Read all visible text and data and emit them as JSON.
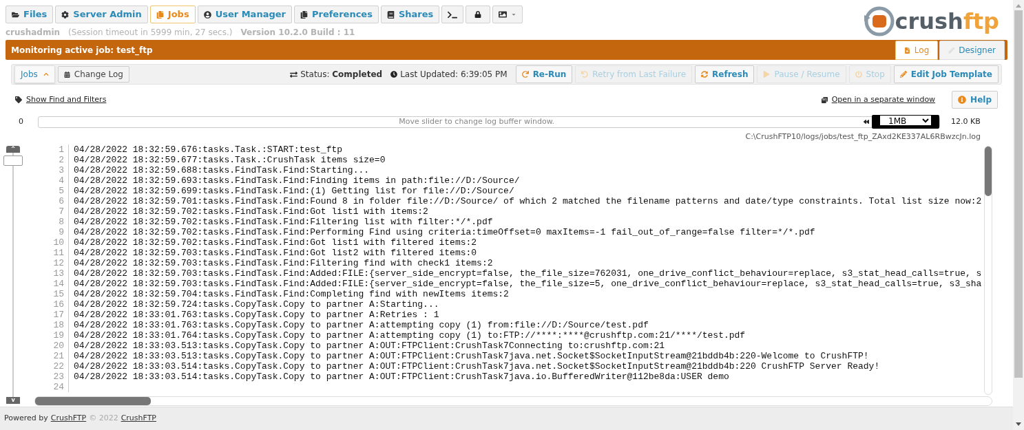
{
  "nav_tabs": [
    {
      "kind": "text",
      "label": "Files",
      "selected": false
    },
    {
      "kind": "text",
      "label": "Server Admin",
      "selected": false
    },
    {
      "kind": "text",
      "label": "Jobs",
      "selected": true
    },
    {
      "kind": "text",
      "label": "User Manager",
      "selected": false
    },
    {
      "kind": "text",
      "label": "Preferences",
      "selected": false
    },
    {
      "kind": "text",
      "label": "Shares",
      "selected": false
    },
    {
      "kind": "terminal",
      "selected": false
    },
    {
      "kind": "lock",
      "selected": false
    },
    {
      "kind": "image",
      "selected": false
    }
  ],
  "logo": {
    "word1": "crush",
    "word2": "ftp"
  },
  "session": {
    "user": "crushadmin",
    "timeout": "(Session timeout in 5999 min, 27 secs.)",
    "version": "Version 10.2.0 Build : 11"
  },
  "banner": {
    "title": "Monitoring active job: test_ftp"
  },
  "view_tabs": [
    {
      "label": "Log",
      "selected": true
    },
    {
      "label": "Designer",
      "selected": false
    }
  ],
  "toolbar": {
    "jobs_menu": "Jobs",
    "change_log": "Change Log",
    "status_label": "Status:",
    "status_value": "Completed",
    "updated_label": "Last Updated:",
    "updated_value": "6:39:05 PM",
    "buttons": [
      {
        "label": "Re-Run",
        "disabled": false
      },
      {
        "label": "Retry from Last Failure",
        "disabled": true
      },
      {
        "label": "Refresh",
        "disabled": false
      },
      {
        "label": "Pause / Resume",
        "disabled": true
      },
      {
        "label": "Stop",
        "disabled": true
      },
      {
        "label": "Edit Job Template",
        "disabled": false
      }
    ]
  },
  "find_link": "Show Find and Filters",
  "open_window_link": "Open in a separate window",
  "help_button": "Help",
  "buffer": {
    "min": "0",
    "hint": "Move slider to change log buffer window.",
    "size_option": "1MB",
    "size": "12.0 KB"
  },
  "log_path": "C:\\CrushFTP10/logs/jobs/test_ftp_ZAxd2KE337AL6RBwzcJn.log",
  "log_lines": [
    {
      "number": "1",
      "text": "04/28/2022 18:32:59.676:tasks.Task.:START:test_ftp"
    },
    {
      "number": "2",
      "text": "04/28/2022 18:32:59.677:tasks.Task.:CrushTask items size=0"
    },
    {
      "number": "3",
      "text": "04/28/2022 18:32:59.688:tasks.FindTask.Find:Starting..."
    },
    {
      "number": "4",
      "text": "04/28/2022 18:32:59.693:tasks.FindTask.Find:Finding items in path:file://D:/Source/"
    },
    {
      "number": "5",
      "text": "04/28/2022 18:32:59.699:tasks.FindTask.Find:(1) Getting list for file://D:/Source/"
    },
    {
      "number": "6",
      "text": "04/28/2022 18:32:59.701:tasks.FindTask.Find:Found 8 in folder file://D:/Source/ of which 2 matched the filename patterns and date/type constraints. Total list size now:2"
    },
    {
      "number": "7",
      "text": "04/28/2022 18:32:59.702:tasks.FindTask.Find:Got list1 with items:2"
    },
    {
      "number": "8",
      "text": "04/28/2022 18:32:59.702:tasks.FindTask.Find:Filtering list with filter:*/*.pdf"
    },
    {
      "number": "9",
      "text": "04/28/2022 18:32:59.702:tasks.FindTask.Find:Performing Find using criteria:timeOffset=0 maxItems=-1 fail_out_of_range=false filter=*/*.pdf"
    },
    {
      "number": "10",
      "text": "04/28/2022 18:32:59.702:tasks.FindTask.Find:Got list1 with filtered items:2"
    },
    {
      "number": "11",
      "text": "04/28/2022 18:32:59.703:tasks.FindTask.Find:Got list2 with filtered items:0"
    },
    {
      "number": "12",
      "text": "04/28/2022 18:32:59.703:tasks.FindTask.Find:Filtering find with check1 items:2"
    },
    {
      "number": "13",
      "text": "04/28/2022 18:32:59.703:tasks.FindTask.Find:Added:FILE:{server_side_encrypt=false, the_file_size=762031, one_drive_conflict_behaviour=replace, s3_stat_head_calls=true, s"
    },
    {
      "number": "14",
      "text": "04/28/2022 18:32:59.703:tasks.FindTask.Find:Added:FILE:{server_side_encrypt=false, the_file_size=5, one_drive_conflict_behaviour=replace, s3_stat_head_calls=true, s3_sha"
    },
    {
      "number": "15",
      "text": "04/28/2022 18:32:59.704:tasks.FindTask.Find:Completing find with newItems items:2"
    },
    {
      "number": "16",
      "text": "04/28/2022 18:32:59.724:tasks.CopyTask.Copy to partner A:Starting..."
    },
    {
      "number": "17",
      "text": "04/28/2022 18:33:01.763:tasks.CopyTask.Copy to partner A:Retries : 1"
    },
    {
      "number": "18",
      "text": "04/28/2022 18:33:01.763:tasks.CopyTask.Copy to partner A:attempting copy (1) from:file://D:/Source/test.pdf"
    },
    {
      "number": "19",
      "text": "04/28/2022 18:33:01.764:tasks.CopyTask.Copy to partner A:attempting copy (1) to:FTP://****:****@crushftp.com:21/****/test.pdf"
    },
    {
      "number": "20",
      "text": "04/28/2022 18:33:03.513:tasks.CopyTask.Copy to partner A:OUT:FTPClient:CrushTask7Connecting to:crushftp.com:21"
    },
    {
      "number": "21",
      "text": "04/28/2022 18:33:03.513:tasks.CopyTask.Copy to partner A:OUT:FTPClient:CrushTask7java.net.Socket$SocketInputStream@21bddb4b:220-Welcome to CrushFTP!"
    },
    {
      "number": "22",
      "text": "04/28/2022 18:33:03.514:tasks.CopyTask.Copy to partner A:OUT:FTPClient:CrushTask7java.net.Socket$SocketInputStream@21bddb4b:220 CrushFTP Server Ready!"
    },
    {
      "number": "23",
      "text": "04/28/2022 18:33:03.514:tasks.CopyTask.Copy to partner A:OUT:FTPClient:CrushTask7java.io.BufferedWriter@112be8da:USER demo"
    },
    {
      "number": "24"
    }
  ],
  "vertical_slider": {
    "up": "^",
    "down": "v",
    "level": 0
  },
  "footer": {
    "prefix": "Powered by",
    "link1": "CrushFTP",
    "copyright": "© 2022",
    "link2": "CrushFTP"
  }
}
